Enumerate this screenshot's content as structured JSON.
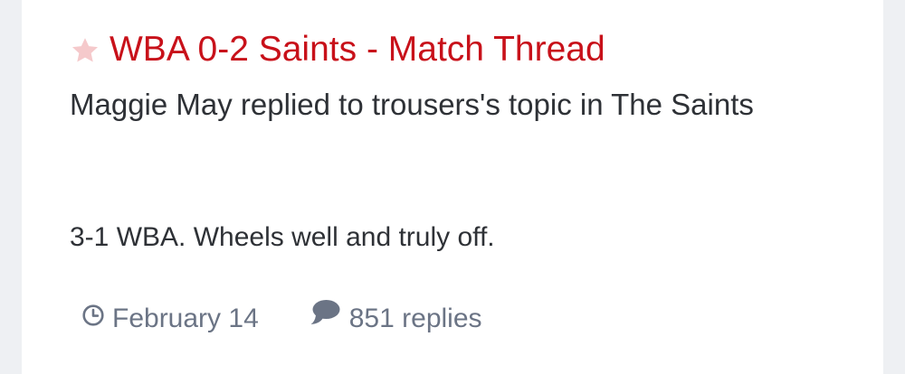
{
  "topic": {
    "title": "WBA 0-2 Saints - Match Thread",
    "summary": "Maggie May replied to trousers's topic in The Saints",
    "snippet": "3-1 WBA. Wheels well and truly off.",
    "date": "February 14",
    "replies": "851 replies"
  },
  "icons": {
    "star": "star-icon",
    "clock": "clock-icon",
    "comment": "comment-icon"
  },
  "colors": {
    "title": "#c8111a",
    "star": "#f5c9cb",
    "meta": "#6b7485",
    "text": "#2e3136",
    "page_background": "#eef0f3",
    "card_background": "#ffffff"
  }
}
